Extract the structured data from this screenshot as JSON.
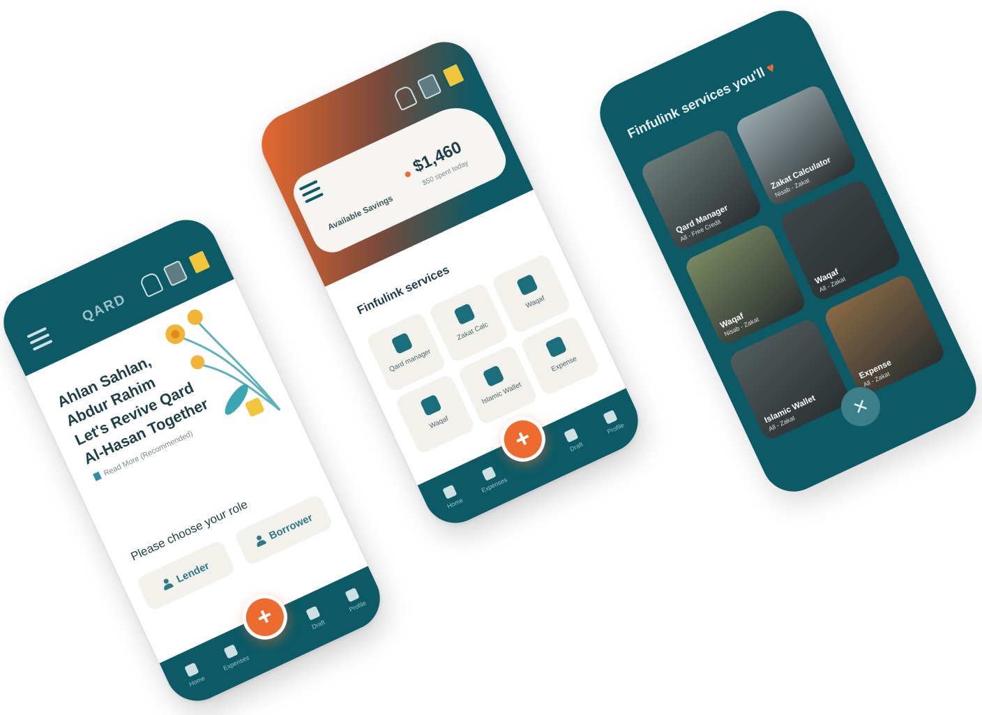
{
  "phone1": {
    "brand": "QARD",
    "greeting": [
      "Ahlan Sahlan,",
      "Abdur Rahim",
      "Let's Revive Qard",
      "Al-Hasan Together"
    ],
    "read_more": "Read More (Recommended)",
    "choose_role": "Please choose your role",
    "lender_label": "Lender",
    "borrower_label": "Borrower",
    "fab": "+",
    "nav": [
      "Home",
      "Expenses",
      "Draft",
      "Profile"
    ]
  },
  "phone2": {
    "available_label": "Available Savings",
    "amount": "$1,460",
    "spent_today": "$50 spent today",
    "section_title": "Finfulink services",
    "services": [
      "Qard manager",
      "Zakat Calc",
      "Waqaf",
      "Waqaf",
      "Islamic Wallet",
      "Expense"
    ],
    "fab": "+",
    "nav": [
      "Home",
      "Expenses",
      "Draft",
      "Profile"
    ]
  },
  "phone3": {
    "title": "Finfulink services you'll",
    "heart": "♥",
    "tiles": [
      {
        "title": "Qard Manager",
        "sub": "All - Free Credit",
        "color": "#6b7b78"
      },
      {
        "title": "Zakat Calculator",
        "sub": "Nisab - Zakat",
        "color": "#9aa9ae"
      },
      {
        "title": "Waqaf",
        "sub": "Nisab - Zakat",
        "color": "#7a8a62"
      },
      {
        "title": "Waqaf",
        "sub": "All - Zakat",
        "color": "#3e4548"
      },
      {
        "title": "Islamic Wallet",
        "sub": "All - Zakat",
        "color": "#525c5d"
      },
      {
        "title": "Expense",
        "sub": "All - Zakat",
        "color": "#8a6a45"
      }
    ],
    "close": "✕"
  }
}
